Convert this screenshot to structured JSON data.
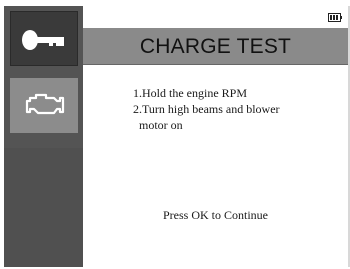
{
  "screen": {
    "title": "CHARGE TEST",
    "sidebar": {
      "items": [
        {
          "icon": "key-icon",
          "selected": true
        },
        {
          "icon": "engine-icon",
          "selected": false
        }
      ]
    },
    "status": {
      "battery_icon": "battery-icon"
    },
    "instructions": {
      "step1": "1.Hold the engine RPM",
      "step2_line1": "2.Turn high beams and blower",
      "step2_line2": "motor on"
    },
    "prompt": "Press OK to Continue"
  },
  "colors": {
    "sidebar": "#545454",
    "selected_item": "#3a3a3a",
    "unselected_item": "#8c8c8c",
    "title_bar": "#8a8a8a"
  }
}
